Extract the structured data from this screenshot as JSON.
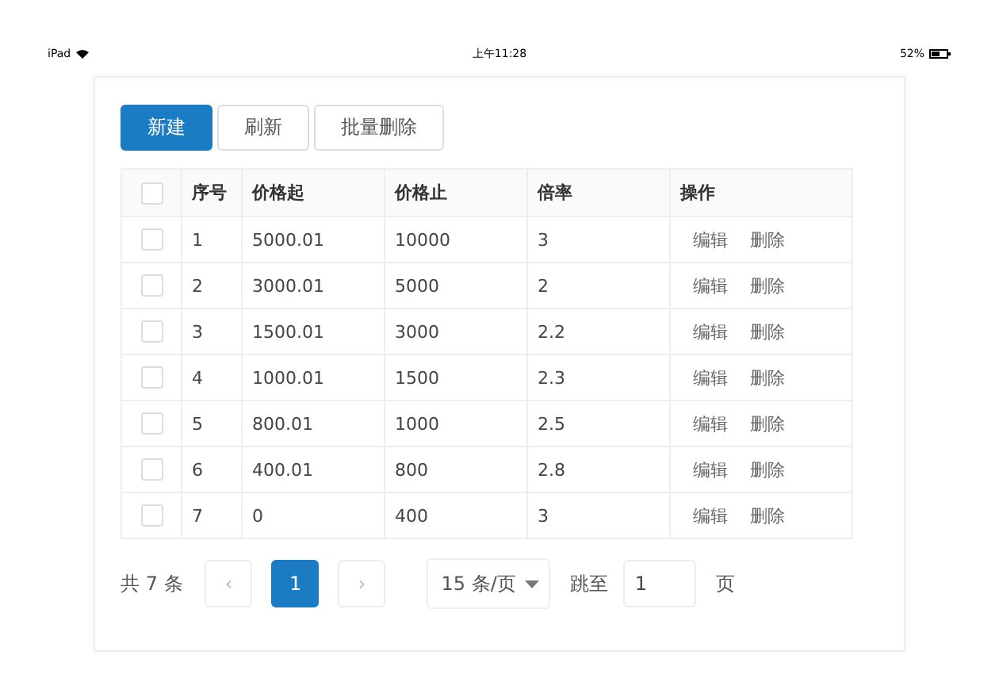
{
  "status_bar": {
    "device": "iPad",
    "time": "上午11:28",
    "battery": "52%"
  },
  "toolbar": {
    "buttons": [
      {
        "label": "新建",
        "kind": "primary"
      },
      {
        "label": "刷新",
        "kind": "default"
      },
      {
        "label": "批量删除",
        "kind": "default"
      }
    ]
  },
  "table": {
    "columns": [
      "序号",
      "价格起",
      "价格止",
      "倍率",
      "操作"
    ],
    "header_checked": false,
    "rows": [
      {
        "checked": false,
        "cells": [
          "1",
          "5000.01",
          "10000",
          "3"
        ],
        "actions": [
          "编辑",
          "删除"
        ]
      },
      {
        "checked": false,
        "cells": [
          "2",
          "3000.01",
          "5000",
          "2"
        ],
        "actions": [
          "编辑",
          "删除"
        ]
      },
      {
        "checked": false,
        "cells": [
          "3",
          "1500.01",
          "3000",
          "2.2"
        ],
        "actions": [
          "编辑",
          "删除"
        ]
      },
      {
        "checked": false,
        "cells": [
          "4",
          "1000.01",
          "1500",
          "2.3"
        ],
        "actions": [
          "编辑",
          "删除"
        ]
      },
      {
        "checked": false,
        "cells": [
          "5",
          "800.01",
          "1000",
          "2.5"
        ],
        "actions": [
          "编辑",
          "删除"
        ]
      },
      {
        "checked": false,
        "cells": [
          "6",
          "400.01",
          "800",
          "2.8"
        ],
        "actions": [
          "编辑",
          "删除"
        ]
      },
      {
        "checked": false,
        "cells": [
          "7",
          "0",
          "400",
          "3"
        ],
        "actions": [
          "编辑",
          "删除"
        ]
      }
    ]
  },
  "pagination": {
    "total": "共 7 条",
    "prev": "‹",
    "pages": [
      {
        "label": "1",
        "selected": true
      }
    ],
    "next": "›",
    "page_size": "15 条/页",
    "jump_label": "跳至",
    "jump_value": "1",
    "page_suffix": "页"
  }
}
